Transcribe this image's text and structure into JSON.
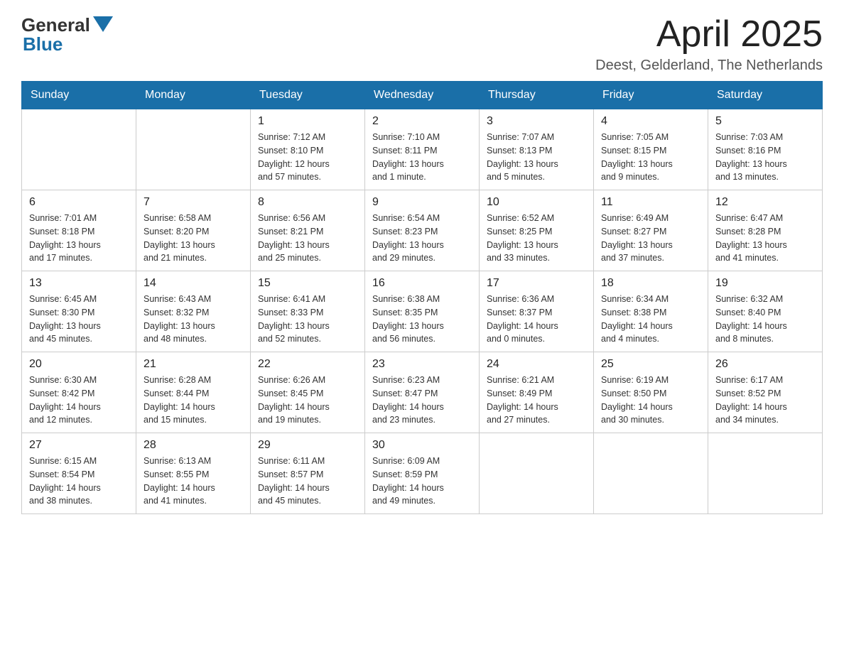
{
  "header": {
    "logo_general": "General",
    "logo_blue": "Blue",
    "title": "April 2025",
    "subtitle": "Deest, Gelderland, The Netherlands"
  },
  "days_of_week": [
    "Sunday",
    "Monday",
    "Tuesday",
    "Wednesday",
    "Thursday",
    "Friday",
    "Saturday"
  ],
  "weeks": [
    [
      {
        "day": "",
        "info": ""
      },
      {
        "day": "",
        "info": ""
      },
      {
        "day": "1",
        "info": "Sunrise: 7:12 AM\nSunset: 8:10 PM\nDaylight: 12 hours\nand 57 minutes."
      },
      {
        "day": "2",
        "info": "Sunrise: 7:10 AM\nSunset: 8:11 PM\nDaylight: 13 hours\nand 1 minute."
      },
      {
        "day": "3",
        "info": "Sunrise: 7:07 AM\nSunset: 8:13 PM\nDaylight: 13 hours\nand 5 minutes."
      },
      {
        "day": "4",
        "info": "Sunrise: 7:05 AM\nSunset: 8:15 PM\nDaylight: 13 hours\nand 9 minutes."
      },
      {
        "day": "5",
        "info": "Sunrise: 7:03 AM\nSunset: 8:16 PM\nDaylight: 13 hours\nand 13 minutes."
      }
    ],
    [
      {
        "day": "6",
        "info": "Sunrise: 7:01 AM\nSunset: 8:18 PM\nDaylight: 13 hours\nand 17 minutes."
      },
      {
        "day": "7",
        "info": "Sunrise: 6:58 AM\nSunset: 8:20 PM\nDaylight: 13 hours\nand 21 minutes."
      },
      {
        "day": "8",
        "info": "Sunrise: 6:56 AM\nSunset: 8:21 PM\nDaylight: 13 hours\nand 25 minutes."
      },
      {
        "day": "9",
        "info": "Sunrise: 6:54 AM\nSunset: 8:23 PM\nDaylight: 13 hours\nand 29 minutes."
      },
      {
        "day": "10",
        "info": "Sunrise: 6:52 AM\nSunset: 8:25 PM\nDaylight: 13 hours\nand 33 minutes."
      },
      {
        "day": "11",
        "info": "Sunrise: 6:49 AM\nSunset: 8:27 PM\nDaylight: 13 hours\nand 37 minutes."
      },
      {
        "day": "12",
        "info": "Sunrise: 6:47 AM\nSunset: 8:28 PM\nDaylight: 13 hours\nand 41 minutes."
      }
    ],
    [
      {
        "day": "13",
        "info": "Sunrise: 6:45 AM\nSunset: 8:30 PM\nDaylight: 13 hours\nand 45 minutes."
      },
      {
        "day": "14",
        "info": "Sunrise: 6:43 AM\nSunset: 8:32 PM\nDaylight: 13 hours\nand 48 minutes."
      },
      {
        "day": "15",
        "info": "Sunrise: 6:41 AM\nSunset: 8:33 PM\nDaylight: 13 hours\nand 52 minutes."
      },
      {
        "day": "16",
        "info": "Sunrise: 6:38 AM\nSunset: 8:35 PM\nDaylight: 13 hours\nand 56 minutes."
      },
      {
        "day": "17",
        "info": "Sunrise: 6:36 AM\nSunset: 8:37 PM\nDaylight: 14 hours\nand 0 minutes."
      },
      {
        "day": "18",
        "info": "Sunrise: 6:34 AM\nSunset: 8:38 PM\nDaylight: 14 hours\nand 4 minutes."
      },
      {
        "day": "19",
        "info": "Sunrise: 6:32 AM\nSunset: 8:40 PM\nDaylight: 14 hours\nand 8 minutes."
      }
    ],
    [
      {
        "day": "20",
        "info": "Sunrise: 6:30 AM\nSunset: 8:42 PM\nDaylight: 14 hours\nand 12 minutes."
      },
      {
        "day": "21",
        "info": "Sunrise: 6:28 AM\nSunset: 8:44 PM\nDaylight: 14 hours\nand 15 minutes."
      },
      {
        "day": "22",
        "info": "Sunrise: 6:26 AM\nSunset: 8:45 PM\nDaylight: 14 hours\nand 19 minutes."
      },
      {
        "day": "23",
        "info": "Sunrise: 6:23 AM\nSunset: 8:47 PM\nDaylight: 14 hours\nand 23 minutes."
      },
      {
        "day": "24",
        "info": "Sunrise: 6:21 AM\nSunset: 8:49 PM\nDaylight: 14 hours\nand 27 minutes."
      },
      {
        "day": "25",
        "info": "Sunrise: 6:19 AM\nSunset: 8:50 PM\nDaylight: 14 hours\nand 30 minutes."
      },
      {
        "day": "26",
        "info": "Sunrise: 6:17 AM\nSunset: 8:52 PM\nDaylight: 14 hours\nand 34 minutes."
      }
    ],
    [
      {
        "day": "27",
        "info": "Sunrise: 6:15 AM\nSunset: 8:54 PM\nDaylight: 14 hours\nand 38 minutes."
      },
      {
        "day": "28",
        "info": "Sunrise: 6:13 AM\nSunset: 8:55 PM\nDaylight: 14 hours\nand 41 minutes."
      },
      {
        "day": "29",
        "info": "Sunrise: 6:11 AM\nSunset: 8:57 PM\nDaylight: 14 hours\nand 45 minutes."
      },
      {
        "day": "30",
        "info": "Sunrise: 6:09 AM\nSunset: 8:59 PM\nDaylight: 14 hours\nand 49 minutes."
      },
      {
        "day": "",
        "info": ""
      },
      {
        "day": "",
        "info": ""
      },
      {
        "day": "",
        "info": ""
      }
    ]
  ]
}
